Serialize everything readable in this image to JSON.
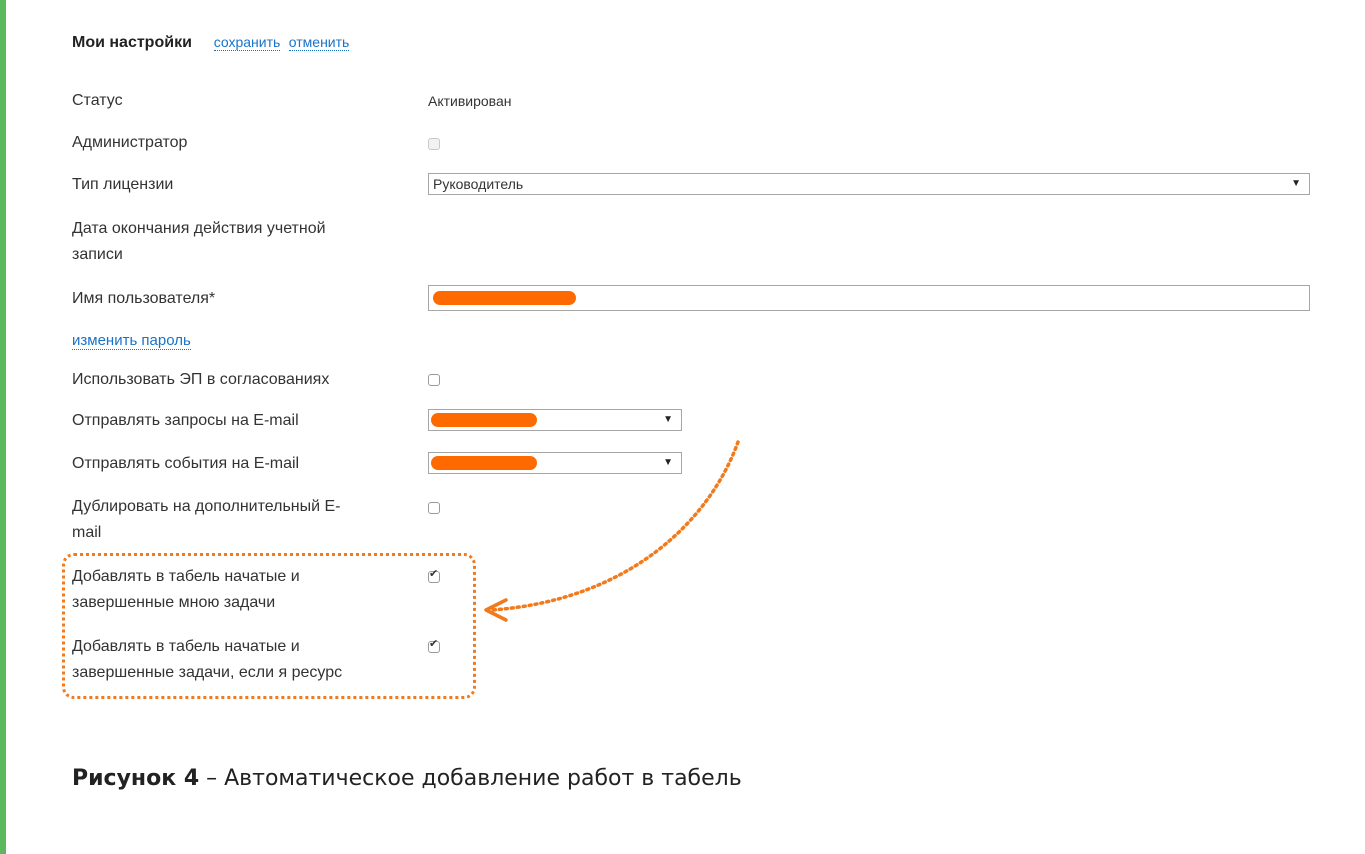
{
  "header": {
    "title": "Мои настройки",
    "save": "сохранить",
    "cancel": "отменить"
  },
  "fields": {
    "status_label": "Статус",
    "status_value": "Активирован",
    "admin_label": "Администратор",
    "license_label": "Тип лицензии",
    "license_value": "Руководитель",
    "expire_label_1": "Дата окончания действия учетной",
    "expire_label_2": "записи",
    "username_label": "Имя пользователя*",
    "change_password": "изменить пароль",
    "use_ep_label": "Использовать ЭП в согласованиях",
    "send_requests_label": "Отправлять запросы на E-mail",
    "send_events_label": "Отправлять события на E-mail",
    "duplicate_label_1": "Дублировать на дополнительный E-",
    "duplicate_label_2": "mail",
    "add_my_tasks_1": "Добавлять в табель начатые и",
    "add_my_tasks_2": "завершенные мною задачи",
    "add_resource_tasks_1": "Добавлять в табель начатые и",
    "add_resource_tasks_2": "завершенные задачи, если я ресурс"
  },
  "checkboxes": {
    "admin": false,
    "use_ep": false,
    "duplicate": false,
    "add_my_tasks": true,
    "add_resource_tasks": true
  },
  "caption": {
    "bold": "Рисунок 4",
    "text": " – Автоматическое добавление работ в табель"
  },
  "colors": {
    "accent_bar": "#5cb85c",
    "link": "#1a73c8",
    "highlight": "#f07a1c",
    "redaction": "#ff6a00"
  }
}
